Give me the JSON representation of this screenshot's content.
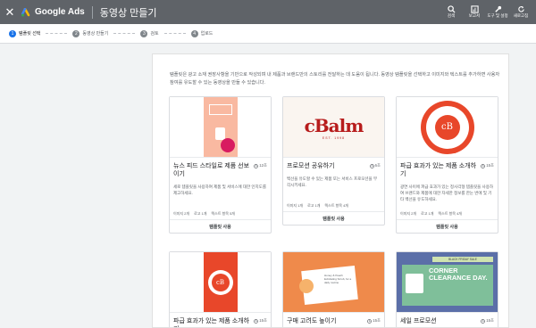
{
  "topbar": {
    "close_label": "✕",
    "brand": "Google Ads",
    "title": "동영상 만들기",
    "tools": [
      {
        "icon": "search-icon",
        "label": "검색"
      },
      {
        "icon": "reports-icon",
        "label": "보고서"
      },
      {
        "icon": "wrench-icon",
        "label": "도구 및 설정"
      },
      {
        "icon": "refresh-icon",
        "label": "새로고침"
      }
    ]
  },
  "steps": [
    {
      "num": "1",
      "label": "템플릿 선택"
    },
    {
      "num": "2",
      "label": "동영상 만들기"
    },
    {
      "num": "3",
      "label": "검토"
    },
    {
      "num": "4",
      "label": "업로드"
    }
  ],
  "intro": "템플릿은 광고 소재 권장사항을 기반으로 작성되며 내 제품과 브랜드만의 스토리를 전달하는 데 도움이 됩니다. 동영상 템플릿을 선택하고 이미지와 텍스트를 추가하면 사용자 참여를 유도할 수 있는 동영상을 만들 수 있습니다.",
  "cards": [
    {
      "name": "뉴스 피드 스타일로 제품 선보이기",
      "duration": "12초",
      "desc": "세로 템플릿을 사용하여 제품 및 서비스에 대한 인지도를 제고하세요.",
      "meta": [
        "이미지 2개",
        "로고 1개",
        "텍스트 항목 5개"
      ],
      "use": "템플릿 사용"
    },
    {
      "name": "프로모션 공유하기",
      "duration": "6초",
      "desc": "백선을 유도할 수 있는 제품 또는 서비스 프로모션을 부각시키세요.",
      "meta": [
        "이미지 1개",
        "로고 1개",
        "텍스트 항목 4개"
      ],
      "use": "템플릿 사용",
      "thumb_text": "cBalm",
      "thumb_sub": "EST. 1998"
    },
    {
      "name": "파급 효과가 있는 제품 소개하기",
      "duration": "15초",
      "desc": "광연 사이에 파급 효과가 있는 정사각형 템플릿을 사용하여 브랜드와 제품에 대한 자세한 정보를 한눈 번에 및 기타 백선을 유도하세요.",
      "meta": [
        "이미지 2개",
        "로고 1개",
        "텍스트 항목 4개"
      ],
      "use": "템플릿 사용",
      "thumb_text": "cB"
    },
    {
      "name": "파급 효과가 있는 제품 소개하기",
      "duration": "15초",
      "thumb_text": "cB"
    },
    {
      "name": "구매 고려도 높이기",
      "duration": "15초",
      "thumb_text": "Honey & Peach Exfoliating Scrub, for a daily routine"
    },
    {
      "name": "세일 프로모션",
      "duration": "15초",
      "thumb_text": "CORNER CLEARANCE DAY.",
      "thumb_banner": "BLACK FRIDAY SALE"
    }
  ],
  "colors": {
    "topbar": "#5f6368",
    "accent": "#1a73e8",
    "brand_red": "#e8472a"
  }
}
